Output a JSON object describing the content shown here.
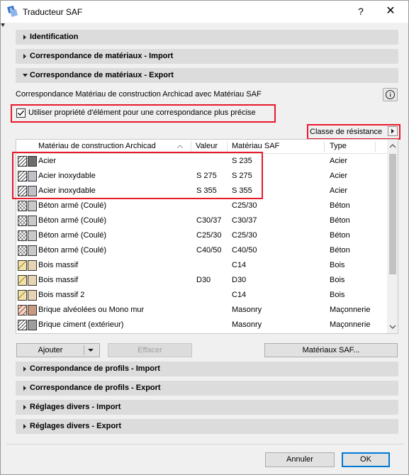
{
  "window": {
    "title": "Traducteur SAF",
    "help": "?",
    "close": "✕"
  },
  "sections_top": [
    {
      "label": "Identification",
      "expanded": false
    },
    {
      "label": "Correspondance de matériaux - Import",
      "expanded": false
    },
    {
      "label": "Correspondance de matériaux - Export",
      "expanded": true
    }
  ],
  "description": "Correspondance Matériau de construction Archicad avec Matériau SAF",
  "checkbox": {
    "label": "Utiliser propriété d'élément pour une correspondance plus précise",
    "checked": true
  },
  "classe_button": "Classe de résistance",
  "table": {
    "headers": [
      "Matériau de construction Archicad",
      "Valeur",
      "Matériau SAF",
      "Type"
    ],
    "rows": [
      {
        "name": "Acier",
        "valeur": "",
        "saf": "S 235",
        "type": "Acier",
        "pattern": "hatch",
        "color": "#6d6d6d"
      },
      {
        "name": "Acier inoxydable",
        "valeur": "S 275",
        "saf": "S 275",
        "type": "Acier",
        "pattern": "hatch",
        "color": "#c0c0c8"
      },
      {
        "name": "Acier inoxydable",
        "valeur": "S 355",
        "saf": "S 355",
        "type": "Acier",
        "pattern": "hatch",
        "color": "#c0c0c8"
      },
      {
        "name": "Béton armé (Coulé)",
        "valeur": "",
        "saf": "C25/30",
        "type": "Béton",
        "pattern": "cross",
        "color": "#c9c9c9"
      },
      {
        "name": "Béton armé (Coulé)",
        "valeur": "C30/37",
        "saf": "C30/37",
        "type": "Béton",
        "pattern": "cross",
        "color": "#c9c9c9"
      },
      {
        "name": "Béton armé (Coulé)",
        "valeur": "C25/30",
        "saf": "C25/30",
        "type": "Béton",
        "pattern": "cross",
        "color": "#c9c9c9"
      },
      {
        "name": "Béton armé (Coulé)",
        "valeur": "C40/50",
        "saf": "C40/50",
        "type": "Béton",
        "pattern": "cross",
        "color": "#c9c9c9"
      },
      {
        "name": "Bois massif",
        "valeur": "",
        "saf": "C14",
        "type": "Bois",
        "pattern": "wood",
        "color": "#e8d3b4"
      },
      {
        "name": "Bois massif",
        "valeur": "D30",
        "saf": "D30",
        "type": "Bois",
        "pattern": "wood",
        "color": "#e8d3b4"
      },
      {
        "name": "Bois massif 2",
        "valeur": "",
        "saf": "C14",
        "type": "Bois",
        "pattern": "wood",
        "color": "#e8d3b4"
      },
      {
        "name": "Brique alvéolées ou Mono mur",
        "valeur": "",
        "saf": "Masonry",
        "type": "Maçonnerie",
        "pattern": "brick",
        "color": "#c89a82"
      },
      {
        "name": "Brique ciment (extérieur)",
        "valeur": "",
        "saf": "Masonry",
        "type": "Maçonnerie",
        "pattern": "hatch",
        "color": "#9e9e9e"
      }
    ]
  },
  "buttons": {
    "ajouter": "Ajouter",
    "effacer": "Effacer",
    "materiaux": "Matériaux SAF..."
  },
  "sections_bottom": [
    {
      "label": "Correspondance de profils - Import",
      "expanded": false
    },
    {
      "label": "Correspondance de profils - Export",
      "expanded": false
    },
    {
      "label": "Réglages divers - Import",
      "expanded": false
    },
    {
      "label": "Réglages divers - Export",
      "expanded": false
    }
  ],
  "footer": {
    "cancel": "Annuler",
    "ok": "OK"
  }
}
